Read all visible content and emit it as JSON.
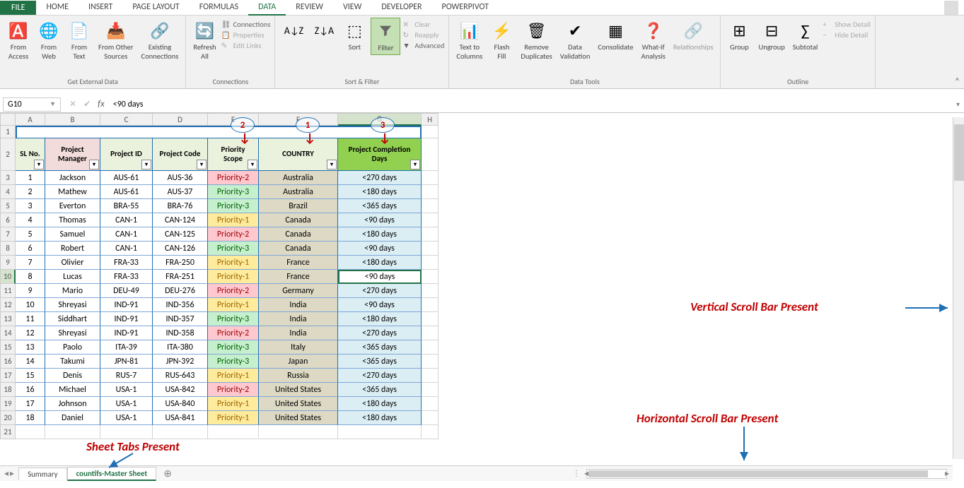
{
  "titlebar": {
    "file": "FILE",
    "tabs": [
      "HOME",
      "INSERT",
      "PAGE LAYOUT",
      "FORMULAS",
      "DATA",
      "REVIEW",
      "VIEW",
      "DEVELOPER",
      "POWERPIVOT"
    ],
    "active_tab": "DATA"
  },
  "ribbon": {
    "get_external_data": {
      "label": "Get External Data",
      "from_access": "From\nAccess",
      "from_web": "From\nWeb",
      "from_text": "From\nText",
      "from_other": "From Other\nSources",
      "existing": "Existing\nConnections"
    },
    "connections": {
      "label": "Connections",
      "refresh": "Refresh\nAll",
      "conn": "Connections",
      "props": "Properties",
      "edit": "Edit Links"
    },
    "sort_filter": {
      "label": "Sort & Filter",
      "sort": "Sort",
      "filter": "Filter",
      "clear": "Clear",
      "reapply": "Reapply",
      "advanced": "Advanced"
    },
    "data_tools": {
      "label": "Data Tools",
      "text_to_cols": "Text to\nColumns",
      "flash_fill": "Flash\nFill",
      "remove_dup": "Remove\nDuplicates",
      "validation": "Data\nValidation",
      "consolidate": "Consolidate",
      "whatif": "What-If\nAnalysis",
      "relationships": "Relationships"
    },
    "outline": {
      "label": "Outline",
      "group": "Group",
      "ungroup": "Ungroup",
      "subtotal": "Subtotal",
      "show_detail": "Show Detail",
      "hide_detail": "Hide Detail"
    }
  },
  "formula_bar": {
    "name_box": "G10",
    "formula": "<90 days"
  },
  "columns": [
    "A",
    "B",
    "C",
    "D",
    "E",
    "F",
    "G",
    "H"
  ],
  "annotated_nums": {
    "e": "2",
    "f": "1",
    "g": "3"
  },
  "headers": {
    "a": "SL No.",
    "b": "Project Manager",
    "c": "Project ID",
    "d": "Project Code",
    "e": "Priority Scope",
    "f": "COUNTRY",
    "g": "Project Completion Days"
  },
  "rows": [
    {
      "n": "1",
      "pm": "Jackson",
      "pid": "AUS-61",
      "code": "AUS-36",
      "pr": "Priority-2",
      "country": "Australia",
      "days": "<270 days"
    },
    {
      "n": "2",
      "pm": "Mathew",
      "pid": "AUS-61",
      "code": "AUS-37",
      "pr": "Priority-3",
      "country": "Australia",
      "days": "<180 days"
    },
    {
      "n": "3",
      "pm": "Everton",
      "pid": "BRA-55",
      "code": "BRA-76",
      "pr": "Priority-3",
      "country": "Brazil",
      "days": "<365 days"
    },
    {
      "n": "4",
      "pm": "Thomas",
      "pid": "CAN-1",
      "code": "CAN-124",
      "pr": "Priority-1",
      "country": "Canada",
      "days": "<90 days"
    },
    {
      "n": "5",
      "pm": "Samuel",
      "pid": "CAN-1",
      "code": "CAN-125",
      "pr": "Priority-2",
      "country": "Canada",
      "days": "<180 days"
    },
    {
      "n": "6",
      "pm": "Robert",
      "pid": "CAN-1",
      "code": "CAN-126",
      "pr": "Priority-3",
      "country": "Canada",
      "days": "<90 days"
    },
    {
      "n": "7",
      "pm": "Olivier",
      "pid": "FRA-33",
      "code": "FRA-250",
      "pr": "Priority-1",
      "country": "France",
      "days": "<180 days"
    },
    {
      "n": "8",
      "pm": "Lucas",
      "pid": "FRA-33",
      "code": "FRA-251",
      "pr": "Priority-1",
      "country": "France",
      "days": "<90 days"
    },
    {
      "n": "9",
      "pm": "Mario",
      "pid": "DEU-49",
      "code": "DEU-276",
      "pr": "Priority-2",
      "country": "Germany",
      "days": "<270 days"
    },
    {
      "n": "10",
      "pm": "Shreyasi",
      "pid": "IND-91",
      "code": "IND-356",
      "pr": "Priority-1",
      "country": "India",
      "days": "<90 days"
    },
    {
      "n": "11",
      "pm": "Siddhart",
      "pid": "IND-91",
      "code": "IND-357",
      "pr": "Priority-3",
      "country": "India",
      "days": "<180 days"
    },
    {
      "n": "12",
      "pm": "Shreyasi",
      "pid": "IND-91",
      "code": "IND-358",
      "pr": "Priority-2",
      "country": "India",
      "days": "<270 days"
    },
    {
      "n": "13",
      "pm": "Paolo",
      "pid": "ITA-39",
      "code": "ITA-380",
      "pr": "Priority-3",
      "country": "Italy",
      "days": "<365 days"
    },
    {
      "n": "14",
      "pm": "Takumi",
      "pid": "JPN-81",
      "code": "JPN-392",
      "pr": "Priority-3",
      "country": "Japan",
      "days": "<365 days"
    },
    {
      "n": "15",
      "pm": "Denis",
      "pid": "RUS-7",
      "code": "RUS-643",
      "pr": "Priority-1",
      "country": "Russia",
      "days": "<270 days"
    },
    {
      "n": "16",
      "pm": "Michael",
      "pid": "USA-1",
      "code": "USA-842",
      "pr": "Priority-2",
      "country": "United States",
      "days": "<365 days"
    },
    {
      "n": "17",
      "pm": "Johnson",
      "pid": "USA-1",
      "code": "USA-840",
      "pr": "Priority-1",
      "country": "United States",
      "days": "<180 days"
    },
    {
      "n": "18",
      "pm": "Daniel",
      "pid": "USA-1",
      "code": "USA-841",
      "pr": "Priority-1",
      "country": "United States",
      "days": "<180 days"
    }
  ],
  "selected_cell_row": 10,
  "sheets": {
    "tab1": "Summary",
    "tab2": "countifs-Master Sheet"
  },
  "annotations": {
    "sheet_tabs": "Sheet Tabs Present",
    "hscroll": "Horizontal Scroll Bar Present",
    "vscroll": "Vertical Scroll Bar Present"
  }
}
